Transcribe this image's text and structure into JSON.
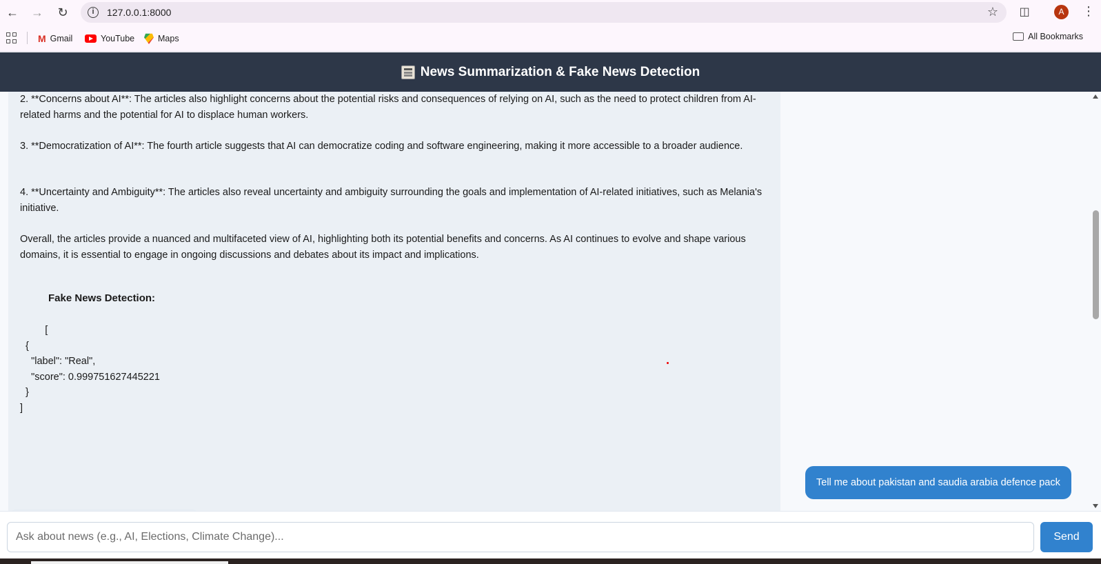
{
  "browser": {
    "url": "127.0.0.1:8000",
    "profile_initial": "A",
    "bookmarks": [
      {
        "label": "Gmail"
      },
      {
        "label": "YouTube"
      },
      {
        "label": "Maps"
      }
    ],
    "all_bookmarks_label": "All Bookmarks"
  },
  "header": {
    "title": "News Summarization & Fake News Detection",
    "icon": "newspaper-icon"
  },
  "chat": {
    "bot_paragraphs": [
      "2. **Concerns about AI**: The articles also highlight concerns about the potential risks and consequences of relying on AI, such as the need to protect children from AI-related harms and the potential for AI to displace human workers.",
      "3. **Democratization of AI**: The fourth article suggests that AI can democratize coding and software engineering, making it more accessible to a broader audience.",
      "4. **Uncertainty and Ambiguity**: The articles also reveal uncertainty and ambiguity surrounding the goals and implementation of AI-related initiatives, such as Melania's initiative.",
      "Overall, the articles provide a nuanced and multifaceted view of AI, highlighting both its potential benefits and concerns. As AI continues to evolve and shape various domains, it is essential to engage in ongoing discussions and debates about its impact and implications."
    ],
    "fake_news_title": "Fake News Detection:",
    "fake_news_json": "         [\n  {\n    \"label\": \"Real\",\n    \"score\": 0.999751627445221\n  }\n]",
    "user_message": "Tell me about pakistan and saudia arabia defence pack"
  },
  "input": {
    "placeholder": "Ask about news (e.g., AI, Elections, Climate Change)...",
    "value": "",
    "send_label": "Send"
  },
  "colors": {
    "header_bg": "#2d3748",
    "accent": "#3182ce",
    "bot_bubble": "#ebf0f5"
  }
}
